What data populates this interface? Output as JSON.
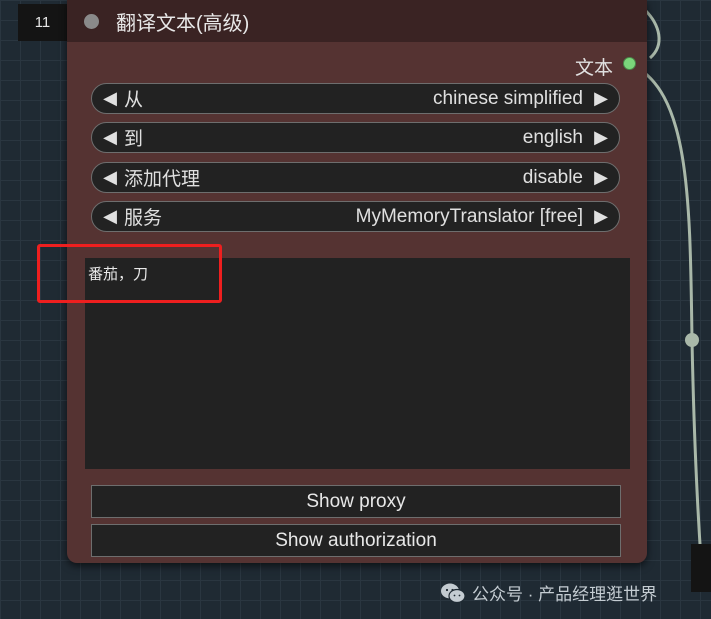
{
  "node": {
    "id": "11",
    "title": "翻译文本(高级)",
    "output_label": "文本",
    "widgets": [
      {
        "label": "从",
        "value": "chinese simplified"
      },
      {
        "label": "到",
        "value": "english"
      },
      {
        "label": "添加代理",
        "value": "disable"
      },
      {
        "label": "服务",
        "value": "MyMemoryTranslator [free]"
      }
    ],
    "text_value": "番茄，刀",
    "buttons": {
      "show_proxy": "Show proxy",
      "show_authorization": "Show authorization"
    }
  },
  "watermark": {
    "text": "公众号 · 产品经理逛世界"
  },
  "colors": {
    "node_body": "#553332",
    "node_header": "#3a2323",
    "output_dot": "#7bd67b",
    "highlight_box": "#ee1f1f",
    "wire": "#a9b8a9"
  }
}
